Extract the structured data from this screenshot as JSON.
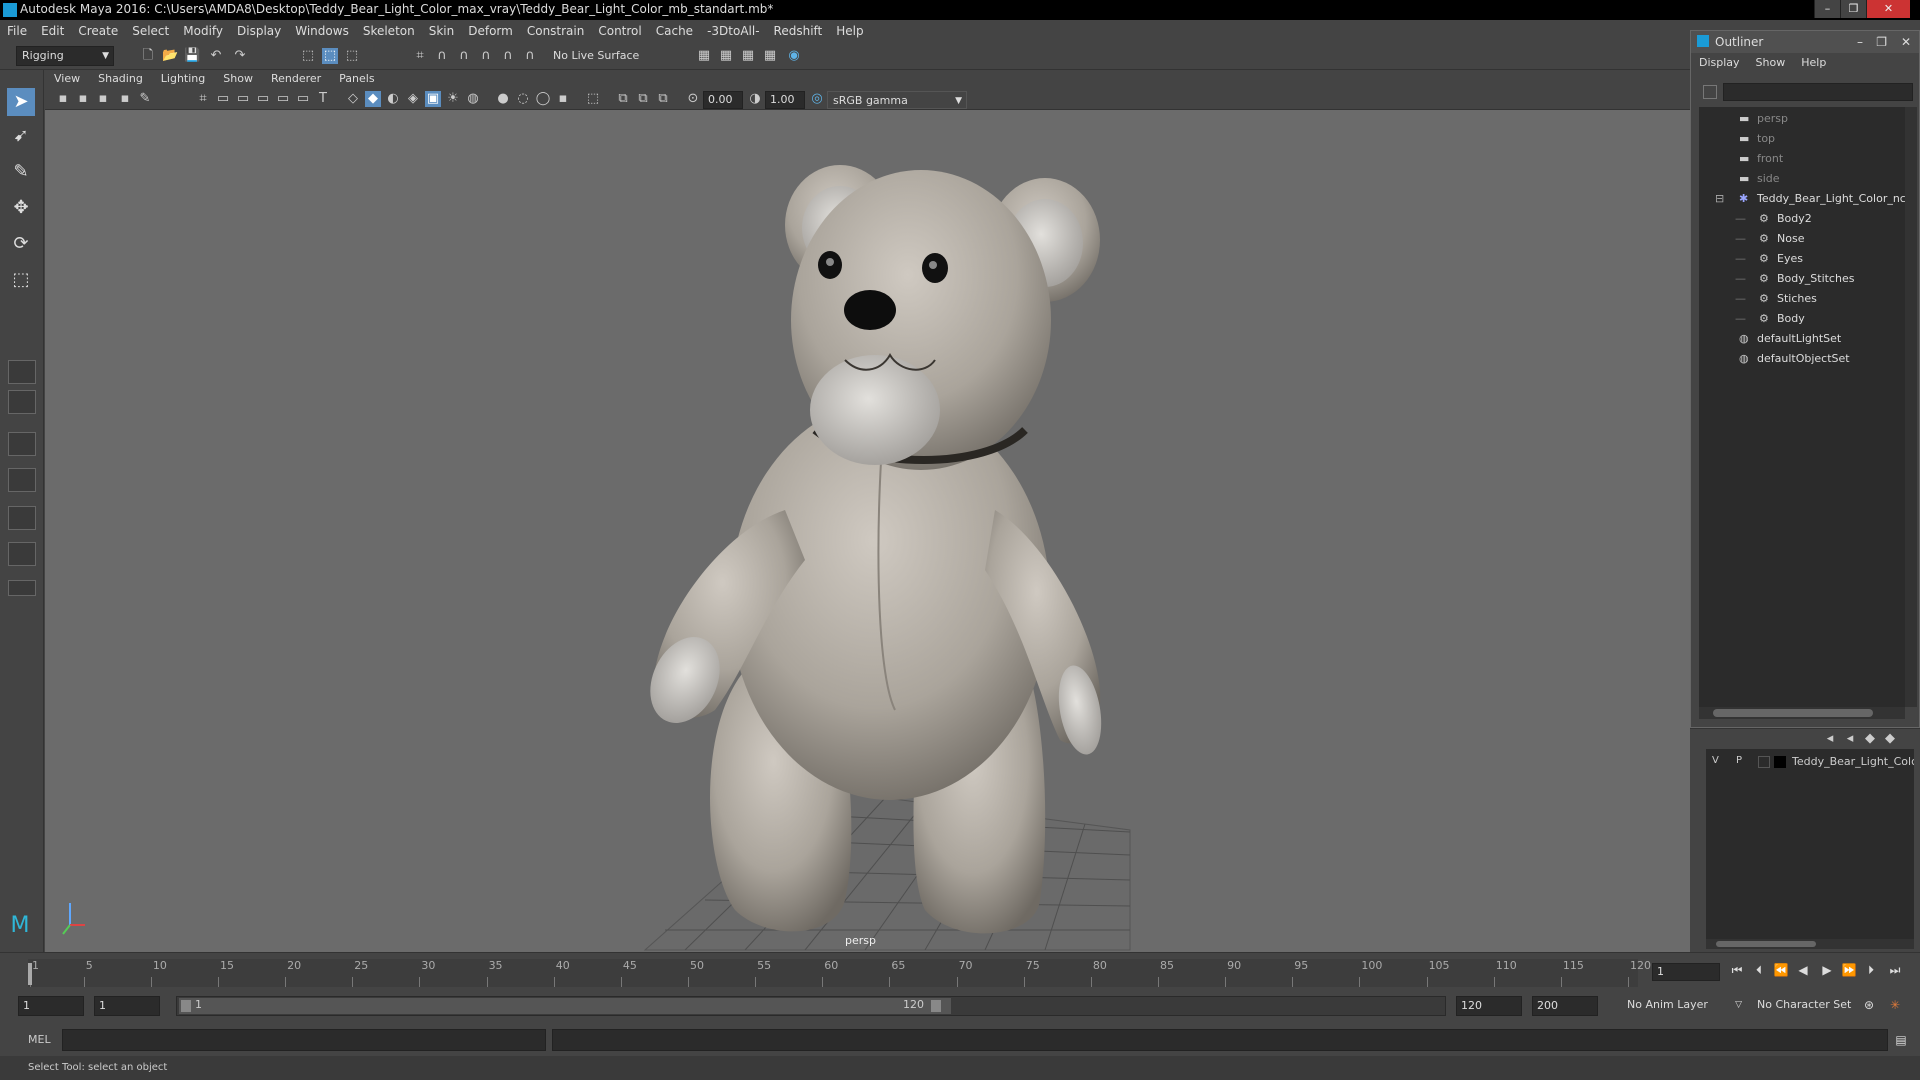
{
  "titlebar": {
    "title": "Autodesk Maya 2016: C:\\Users\\AMDA8\\Desktop\\Teddy_Bear_Light_Color_max_vray\\Teddy_Bear_Light_Color_mb_standart.mb*"
  },
  "menubar": {
    "items": [
      "File",
      "Edit",
      "Create",
      "Select",
      "Modify",
      "Display",
      "Windows",
      "Skeleton",
      "Skin",
      "Deform",
      "Constrain",
      "Control",
      "Cache",
      "-3DtoAll-",
      "Redshift",
      "Help"
    ]
  },
  "shelf": {
    "mode": "Rigging",
    "live_surface": "No Live Surface"
  },
  "viewport": {
    "menu": [
      "View",
      "Shading",
      "Lighting",
      "Show",
      "Renderer",
      "Panels"
    ],
    "exposure": "0.00",
    "gamma": "1.00",
    "color_space": "sRGB gamma",
    "camera_label": "persp"
  },
  "outliner": {
    "title": "Outliner",
    "menu": [
      "Display",
      "Show",
      "Help"
    ],
    "items": [
      {
        "label": "persp",
        "dim": true,
        "indent": 0,
        "icon": "camera"
      },
      {
        "label": "top",
        "dim": true,
        "indent": 0,
        "icon": "camera"
      },
      {
        "label": "front",
        "dim": true,
        "indent": 0,
        "icon": "camera"
      },
      {
        "label": "side",
        "dim": true,
        "indent": 0,
        "icon": "camera"
      },
      {
        "label": "Teddy_Bear_Light_Color_ncl",
        "dim": false,
        "indent": 0,
        "icon": "group"
      },
      {
        "label": "Body2",
        "dim": false,
        "indent": 1,
        "icon": "mesh"
      },
      {
        "label": "Nose",
        "dim": false,
        "indent": 1,
        "icon": "mesh"
      },
      {
        "label": "Eyes",
        "dim": false,
        "indent": 1,
        "icon": "mesh"
      },
      {
        "label": "Body_Stitches",
        "dim": false,
        "indent": 1,
        "icon": "mesh"
      },
      {
        "label": "Stiches",
        "dim": false,
        "indent": 1,
        "icon": "mesh"
      },
      {
        "label": "Body",
        "dim": false,
        "indent": 1,
        "icon": "mesh"
      },
      {
        "label": "defaultLightSet",
        "dim": false,
        "indent": 0,
        "icon": "set"
      },
      {
        "label": "defaultObjectSet",
        "dim": false,
        "indent": 0,
        "icon": "set"
      }
    ]
  },
  "layers": {
    "v": "V",
    "p": "P",
    "name": "Teddy_Bear_Light_Colc"
  },
  "timeline": {
    "ticks": [
      1,
      5,
      10,
      15,
      20,
      25,
      30,
      35,
      40,
      45,
      50,
      55,
      60,
      65,
      70,
      75,
      80,
      85,
      90,
      95,
      100,
      105,
      110,
      115,
      120
    ],
    "current_frame": "1"
  },
  "range": {
    "start": "1",
    "playback_start": "1",
    "slider_start": "1",
    "slider_end": "120",
    "playback_end": "120",
    "end": "200",
    "anim_layer": "No Anim Layer",
    "character_set": "No Character Set"
  },
  "cmdline": {
    "label": "MEL"
  },
  "status": {
    "text": "Select Tool: select an object"
  }
}
